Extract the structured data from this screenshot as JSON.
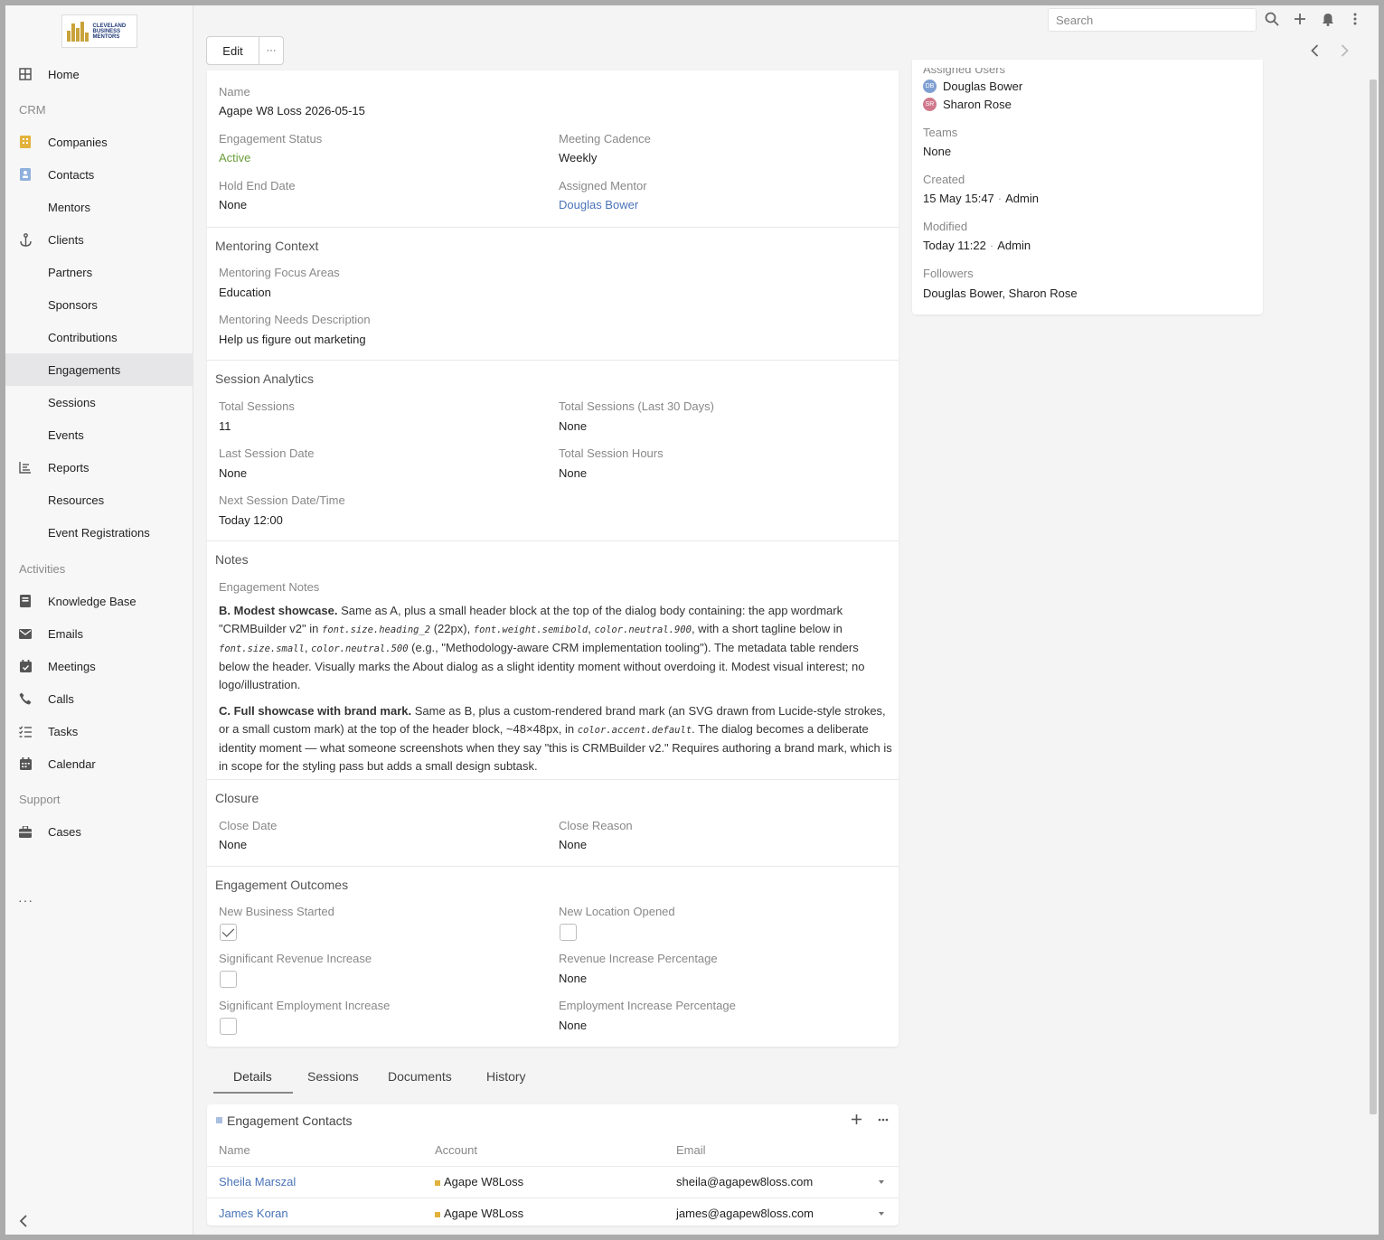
{
  "sidebar": {
    "logo_text": "CLEVELAND BUSINESS MENTORS",
    "items": [
      {
        "label": "Home",
        "icon": "grid-icon"
      },
      {
        "label": "Companies",
        "icon": "building-icon"
      },
      {
        "label": "Contacts",
        "icon": "contact-card-icon"
      },
      {
        "label": "Mentors"
      },
      {
        "label": "Clients",
        "icon": "anchor-icon"
      },
      {
        "label": "Partners"
      },
      {
        "label": "Sponsors"
      },
      {
        "label": "Contributions"
      },
      {
        "label": "Engagements"
      },
      {
        "label": "Sessions"
      },
      {
        "label": "Events"
      },
      {
        "label": "Reports",
        "icon": "bar-chart-icon"
      },
      {
        "label": "Resources"
      },
      {
        "label": "Event Registrations"
      },
      {
        "label": "Knowledge Base",
        "icon": "book-icon"
      },
      {
        "label": "Emails",
        "icon": "envelope-icon"
      },
      {
        "label": "Meetings",
        "icon": "calendar-check-icon"
      },
      {
        "label": "Calls",
        "icon": "phone-icon"
      },
      {
        "label": "Tasks",
        "icon": "task-list-icon"
      },
      {
        "label": "Calendar",
        "icon": "calendar-icon"
      },
      {
        "label": "Cases",
        "icon": "briefcase-icon"
      }
    ],
    "groups": {
      "crm": "CRM",
      "activities": "Activities",
      "support": "Support"
    },
    "active": "Engagements",
    "more": "···"
  },
  "topbar": {
    "search_placeholder": "Search"
  },
  "toolbar": {
    "edit_label": "Edit",
    "more_label": "···"
  },
  "record": {
    "name_label": "Name",
    "name_value": "Agape W8 Loss 2026-05-15",
    "engagement_status_label": "Engagement Status",
    "engagement_status_value": "Active",
    "meeting_cadence_label": "Meeting Cadence",
    "meeting_cadence_value": "Weekly",
    "hold_end_date_label": "Hold End Date",
    "hold_end_date_value": "None",
    "assigned_mentor_label": "Assigned Mentor",
    "assigned_mentor_value": "Douglas Bower"
  },
  "mentoring_context": {
    "title": "Mentoring Context",
    "focus_label": "Mentoring Focus Areas",
    "focus_value": "Education",
    "needs_label": "Mentoring Needs Description",
    "needs_value": "Help us figure out marketing"
  },
  "session_analytics": {
    "title": "Session Analytics",
    "total_sessions_label": "Total Sessions",
    "total_sessions_value": "11",
    "total_sessions_30_label": "Total Sessions (Last 30 Days)",
    "total_sessions_30_value": "None",
    "last_session_label": "Last Session Date",
    "last_session_value": "None",
    "total_hours_label": "Total Session Hours",
    "total_hours_value": "None",
    "next_session_label": "Next Session Date/Time",
    "next_session_value": "Today 12:00"
  },
  "notes": {
    "title": "Notes",
    "label": "Engagement Notes",
    "p1_bold": "B. Modest showcase.",
    "p1_a": " Same as A, plus a small header block at the top of the dialog body containing: the app wordmark \"CRMBuilder v2\" in ",
    "p1_code1": "font.size.heading_2",
    "p1_b": " (22px), ",
    "p1_code2": "font.weight.semibold",
    "p1_c": ", ",
    "p1_code3": "color.neutral.900",
    "p1_d": ", with a short tagline below in ",
    "p1_code4": "font.size.small",
    "p1_e": ", ",
    "p1_code5": "color.neutral.500",
    "p1_f": " (e.g., \"Methodology-aware CRM implementation tooling\"). The metadata table renders below the header. Visually marks the About dialog as a slight identity moment without overdoing it. Modest visual interest; no logo/illustration.",
    "p2_bold": "C. Full showcase with brand mark.",
    "p2_a": " Same as B, plus a custom-rendered brand mark (an SVG drawn from Lucide-style strokes, or a small custom mark) at the top of the header block, ~48×48px, in ",
    "p2_code1": "color.accent.default",
    "p2_b": ". The dialog becomes a deliberate identity moment — what someone screenshots when they say \"this is CRMBuilder v2.\" Requires authoring a brand mark, which is in scope for the styling pass but adds a small design subtask."
  },
  "closure": {
    "title": "Closure",
    "close_date_label": "Close Date",
    "close_date_value": "None",
    "close_reason_label": "Close Reason",
    "close_reason_value": "None"
  },
  "outcomes": {
    "title": "Engagement Outcomes",
    "new_business_label": "New Business Started",
    "new_business_checked": true,
    "new_location_label": "New Location Opened",
    "new_location_checked": false,
    "revenue_increase_label": "Significant Revenue Increase",
    "revenue_increase_checked": false,
    "revenue_pct_label": "Revenue Increase Percentage",
    "revenue_pct_value": "None",
    "employment_increase_label": "Significant Employment Increase",
    "employment_increase_checked": false,
    "employment_pct_label": "Employment Increase Percentage",
    "employment_pct_value": "None"
  },
  "side": {
    "assigned_users_label": "Assigned Users",
    "users": [
      {
        "initials": "DB",
        "name": "Douglas Bower",
        "color": "#7e9fd1"
      },
      {
        "initials": "SR",
        "name": "Sharon Rose",
        "color": "#d0788c"
      }
    ],
    "teams_label": "Teams",
    "teams_value": "None",
    "created_label": "Created",
    "created_time": "15 May 15:47",
    "created_by": "Admin",
    "modified_label": "Modified",
    "modified_time": "Today 11:22",
    "modified_by": "Admin",
    "followers_label": "Followers",
    "followers_value": "Douglas Bower, Sharon Rose"
  },
  "tabs": [
    "Details",
    "Sessions",
    "Documents",
    "History"
  ],
  "engagement_contacts": {
    "title": "Engagement Contacts",
    "columns": [
      "Name",
      "Account",
      "Email"
    ],
    "rows": [
      {
        "name": "Sheila Marszal",
        "account": "Agape W8Loss",
        "email": "sheila@agapew8loss.com"
      },
      {
        "name": "James Koran",
        "account": "Agape W8Loss",
        "email": "james@agapew8loss.com"
      }
    ]
  },
  "colors": {
    "link": "#4a74b8",
    "status_active": "#6a9f3a",
    "sidebar_active": "#e6e6e8",
    "accent_building": "#e3b23c"
  }
}
